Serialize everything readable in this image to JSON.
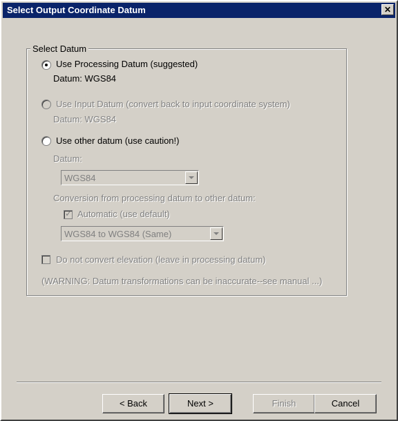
{
  "window": {
    "title": "Select Output Coordinate Datum",
    "close_label": "✕"
  },
  "group": {
    "label": "Select Datum"
  },
  "options": {
    "processing": {
      "label": "Use Processing Datum (suggested)",
      "datum_text": "Datum: WGS84",
      "selected": true
    },
    "input": {
      "label": "Use Input Datum (convert back to input coordinate system)",
      "datum_text": "Datum: WGS84",
      "enabled": false
    },
    "other": {
      "label": "Use other datum (use caution!)",
      "selected": false
    }
  },
  "other_datum": {
    "datum_label": "Datum:",
    "datum_value": "WGS84",
    "conversion_label": "Conversion from processing datum to other datum:",
    "automatic_label": "Automatic (use default)",
    "automatic_checked": true,
    "conversion_value": "WGS84 to WGS84 (Same)"
  },
  "elevation": {
    "label": "Do not convert elevation (leave in processing datum)",
    "checked": false
  },
  "warning": "(WARNING: Datum transformations can be inaccurate--see manual ...)",
  "buttons": {
    "back": "< Back",
    "next": "Next >",
    "finish": "Finish",
    "cancel": "Cancel"
  }
}
